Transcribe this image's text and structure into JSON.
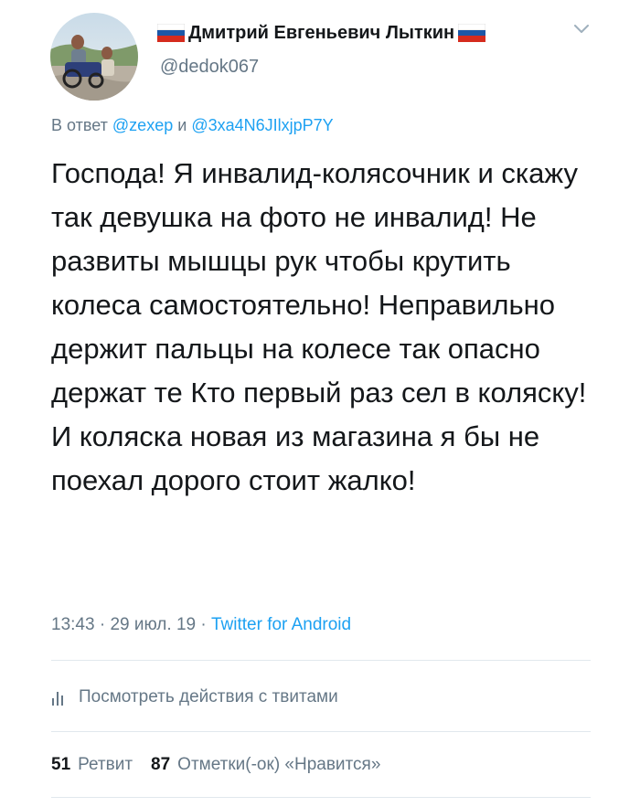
{
  "tweet": {
    "author": {
      "display_name": "Дмитрий Евгеньевич Лыткин",
      "handle": "@dedok067",
      "flag_icon": "russia-flag-icon",
      "avatar_icon": "profile-avatar"
    },
    "reply": {
      "prefix": "В ответ",
      "mention1": "@zexep",
      "joiner": "и",
      "mention2": "@3xa4N6JIlxjpP7Y"
    },
    "text": "Господа! Я инвалид-колясочник и скажу так девушка на фото не инвалид! Не развиты мышцы рук чтобы крутить колеса самостоятельно! Неправильно держит пальцы на колесе так опасно держат те Кто первый раз сел в коляску! И коляска новая из магазина я бы не поехал дорого стоит жалко!",
    "meta": {
      "time": "13:43",
      "separator": "·",
      "date": "29 июл. 19",
      "source": "Twitter for Android"
    },
    "activity": {
      "label": "Посмотреть действия с твитами",
      "icon": "analytics-bars-icon"
    },
    "stats": {
      "retweets_count": "51",
      "retweets_label": "Ретвит",
      "likes_count": "87",
      "likes_label": "Отметки(-ок) «Нравится»"
    }
  },
  "colors": {
    "text": "#14171a",
    "muted": "#657786",
    "link": "#1da1f2",
    "divider": "#e1e8ed"
  }
}
